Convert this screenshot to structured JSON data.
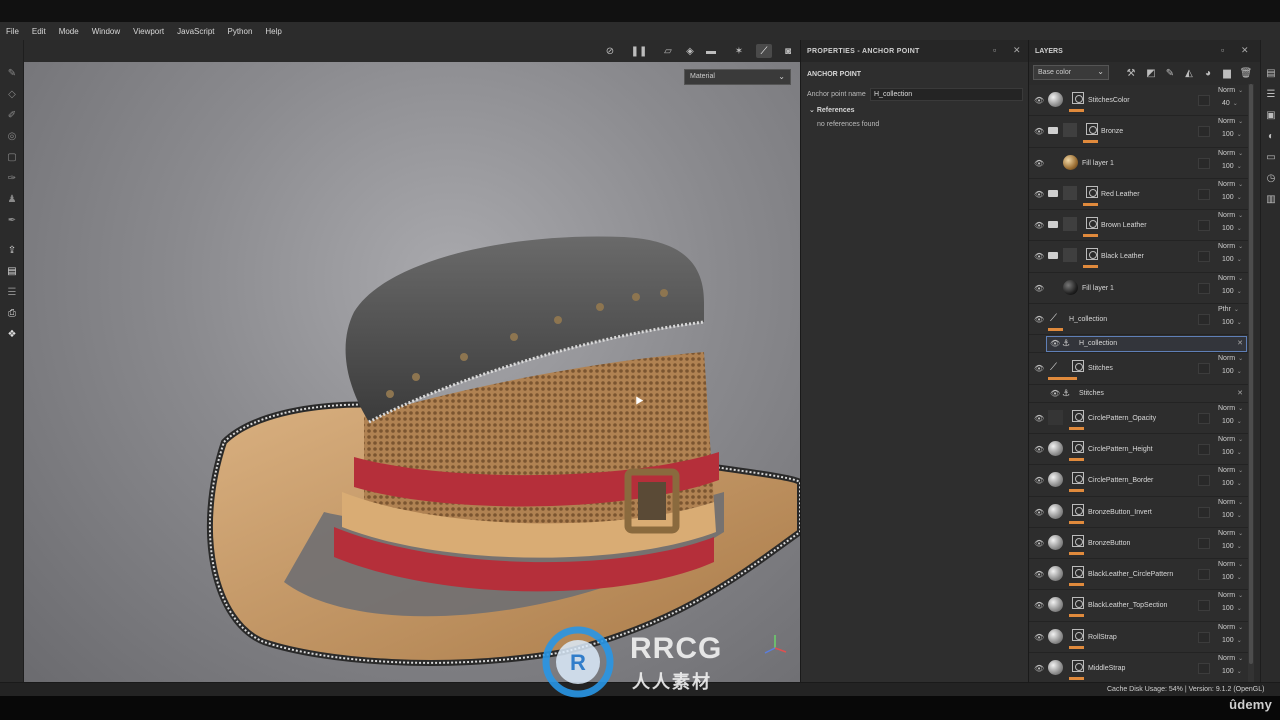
{
  "menu": [
    "File",
    "Edit",
    "Mode",
    "Window",
    "Viewport",
    "JavaScript",
    "Python",
    "Help"
  ],
  "viewport": {
    "material_dropdown": "Material"
  },
  "properties": {
    "title": "PROPERTIES - ANCHOR POINT",
    "section_title": "ANCHOR POINT",
    "anchor_label": "Anchor point name",
    "anchor_value": "H_collection",
    "references_label": "References",
    "references_empty": "no references found"
  },
  "layers": {
    "title": "LAYERS",
    "blend_mode": "Base color",
    "rows": [
      {
        "name": "StitchesColor",
        "blend": "Norm",
        "opacity": "40"
      },
      {
        "name": "Bronze",
        "blend": "Norm",
        "opacity": "100"
      },
      {
        "name": "Fill layer 1",
        "blend": "Norm",
        "opacity": "100"
      },
      {
        "name": "Red Leather",
        "blend": "Norm",
        "opacity": "100"
      },
      {
        "name": "Brown Leather",
        "blend": "Norm",
        "opacity": "100"
      },
      {
        "name": "Black Leather",
        "blend": "Norm",
        "opacity": "100"
      },
      {
        "name": "Fill layer 1",
        "blend": "Norm",
        "opacity": "100"
      },
      {
        "name": "H_collection",
        "blend": "Pthr",
        "opacity": "100"
      },
      {
        "name": "H_collection"
      },
      {
        "name": "Stitches",
        "blend": "Norm",
        "opacity": "100"
      },
      {
        "name": "Stitches"
      },
      {
        "name": "CirclePattern_Opacity",
        "blend": "Norm",
        "opacity": "100"
      },
      {
        "name": "CirclePattern_Height",
        "blend": "Norm",
        "opacity": "100"
      },
      {
        "name": "CirclePattern_Border",
        "blend": "Norm",
        "opacity": "100"
      },
      {
        "name": "BronzeButton_Invert",
        "blend": "Norm",
        "opacity": "100"
      },
      {
        "name": "BronzeButton",
        "blend": "Norm",
        "opacity": "100"
      },
      {
        "name": "BlackLeather_CirclePattern",
        "blend": "Norm",
        "opacity": "100"
      },
      {
        "name": "BlackLeather_TopSection",
        "blend": "Norm",
        "opacity": "100"
      },
      {
        "name": "RollStrap",
        "blend": "Norm",
        "opacity": "100"
      },
      {
        "name": "MiddleStrap",
        "blend": "Norm",
        "opacity": "100"
      }
    ]
  },
  "status": {
    "text": "Cache Disk Usage:   54% | Version: 9.1.2 (OpenGL)"
  },
  "watermark": {
    "brand": "RRCG",
    "sub": "人人素材",
    "udemy": "ûdemy"
  },
  "colors": {
    "accent_orange": "#e08a3c",
    "selection_blue": "#5f7fb6"
  }
}
